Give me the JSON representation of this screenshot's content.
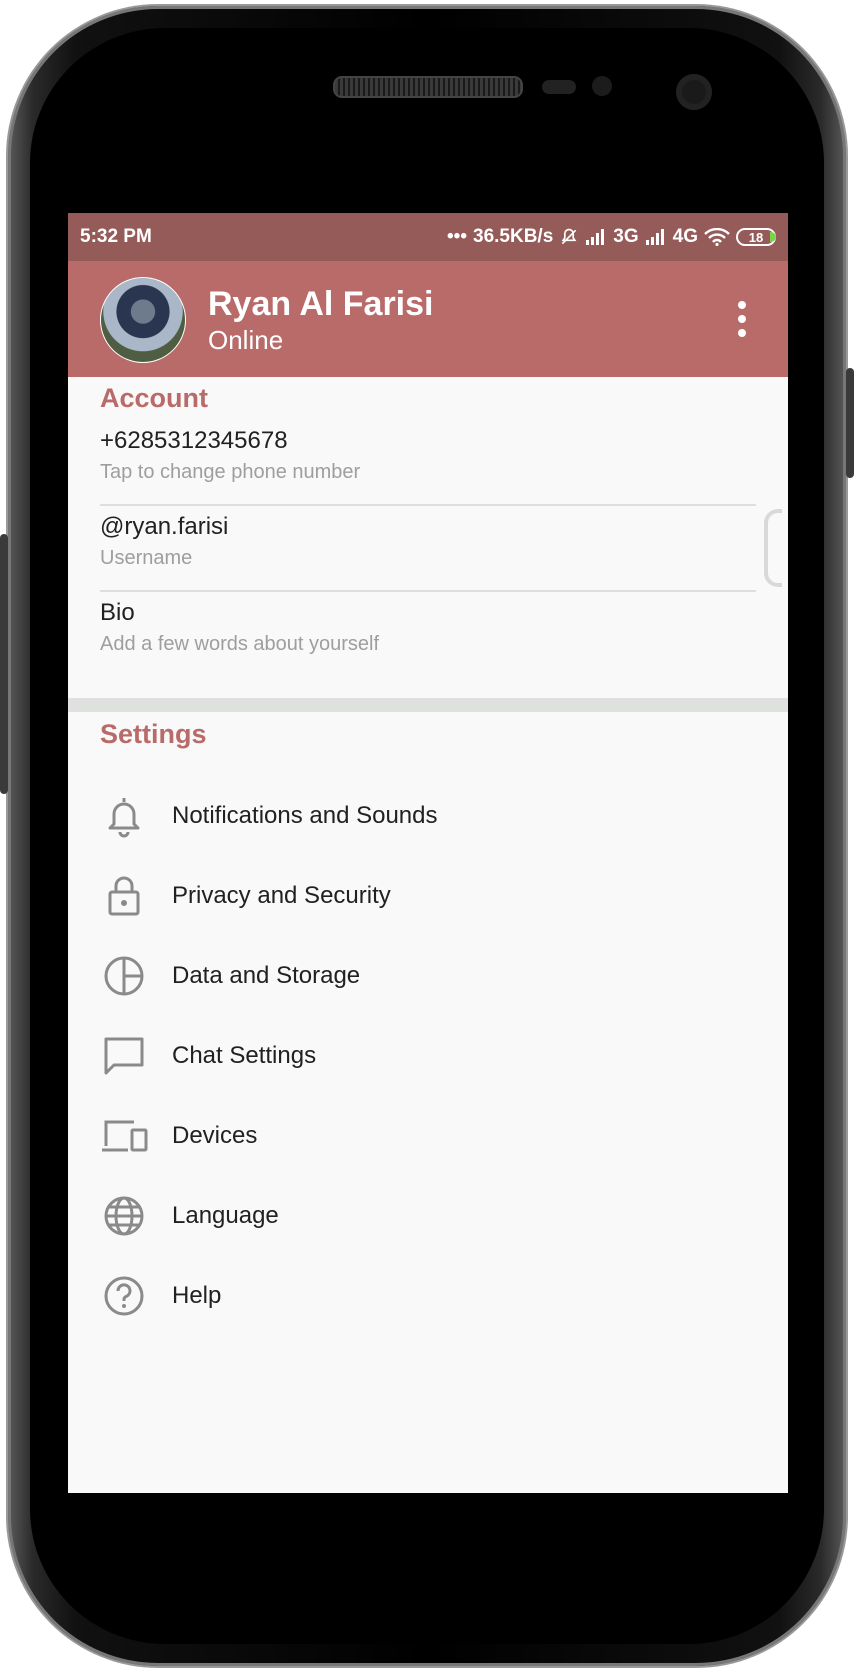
{
  "status_bar": {
    "time": "5:32 PM",
    "net_speed": "36.5KB/s",
    "network_1": "3G",
    "network_2": "4G",
    "battery": "18"
  },
  "profile": {
    "name": "Ryan Al Farisi",
    "status": "Online"
  },
  "account": {
    "title": "Account",
    "phone": {
      "value": "+6285312345678",
      "hint": "Tap to change phone number"
    },
    "username": {
      "value": "@ryan.farisi",
      "hint": "Username"
    },
    "bio": {
      "value": "Bio",
      "hint": "Add a few words about yourself"
    }
  },
  "settings": {
    "title": "Settings",
    "items": [
      {
        "label": "Notifications and Sounds",
        "icon": "bell-icon"
      },
      {
        "label": "Privacy and Security",
        "icon": "lock-icon"
      },
      {
        "label": "Data and Storage",
        "icon": "pie-chart-icon"
      },
      {
        "label": "Chat Settings",
        "icon": "chat-bubble-icon"
      },
      {
        "label": "Devices",
        "icon": "devices-icon"
      },
      {
        "label": "Language",
        "icon": "globe-icon"
      },
      {
        "label": "Help",
        "icon": "help-icon"
      }
    ]
  },
  "colors": {
    "status_bar": "#955b59",
    "app_bar": "#b86b69",
    "accent_text": "#b86b69",
    "background": "#f9f9f9"
  }
}
